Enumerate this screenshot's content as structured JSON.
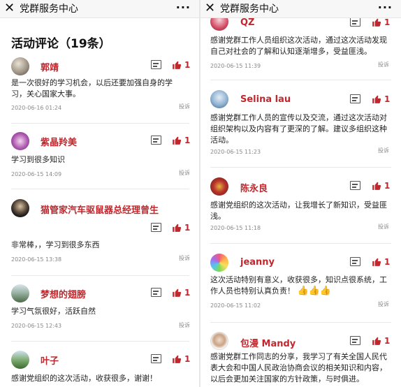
{
  "app": {
    "close_icon": "close-icon",
    "more_icon": "more-icon",
    "title": "党群服务中心",
    "more": "···"
  },
  "left": {
    "section_title": "活动评论（19条）",
    "comments": [
      {
        "name": "郭靖",
        "text": "是一次很好的学习机会，以后还要加强自身的学习，关心国家大事。",
        "time": "2020-06-16 01:24",
        "likes": "1",
        "report": "投诉"
      },
      {
        "name": "紫晶羚美",
        "text": "学习到很多知识",
        "time": "2020-06-15 14:09",
        "likes": "1",
        "report": "投诉"
      },
      {
        "name": "猫管家汽车驱鼠器总经理曾生",
        "text": "非常棒，，学习到很多东西",
        "time": "2020-06-15 13:38",
        "likes": "1",
        "report": "投诉"
      },
      {
        "name": "梦想的翅膀",
        "text": "学习气氛很好，活跃自然",
        "time": "2020-06-15 12:43",
        "likes": "1",
        "report": "投诉"
      },
      {
        "name": "叶子",
        "text": "感谢党组织的这次活动，收获很多，谢谢！",
        "likes": "1"
      }
    ]
  },
  "right": {
    "comments": [
      {
        "name": "QZ",
        "text": "感谢党群工作人员组织这次活动，通过这次活动发现自己对社会的了解和认知逐渐增多，受益匪浅。",
        "time": "2020-06-15 11:39",
        "likes": "1",
        "report": "投诉"
      },
      {
        "name": "Selina lau",
        "text": "感谢党群工作人员的宣传以及交流，通过这次活动对组织架构以及内容有了更深的了解。建议多组织这种活动。",
        "time": "2020-06-15 11:23",
        "likes": "1",
        "report": "投诉"
      },
      {
        "name": "陈永良",
        "text": "感谢党组织的这次活动，让我增长了新知识，受益匪浅。",
        "time": "2020-06-15 11:18",
        "likes": "1",
        "report": "投诉"
      },
      {
        "name": "jeanny",
        "text": "这次活动特别有意义，收获很多，知识点很系统，工作人员也特别认真负责！",
        "emoji": "👍👍👍",
        "time": "2020-06-15 11:02",
        "likes": "1",
        "report": "投诉"
      },
      {
        "name": "包漫 Mandy",
        "text": "感谢党群工作同志的分享，我学习了有关全国人民代表大会和中国人民政治协商会议的相关知识和内容，以后会更加关注国家的方针政策，与时俱进。",
        "likes": "1"
      }
    ]
  },
  "colors": {
    "accent": "#c1272d",
    "bar": "#f7f7f7"
  }
}
